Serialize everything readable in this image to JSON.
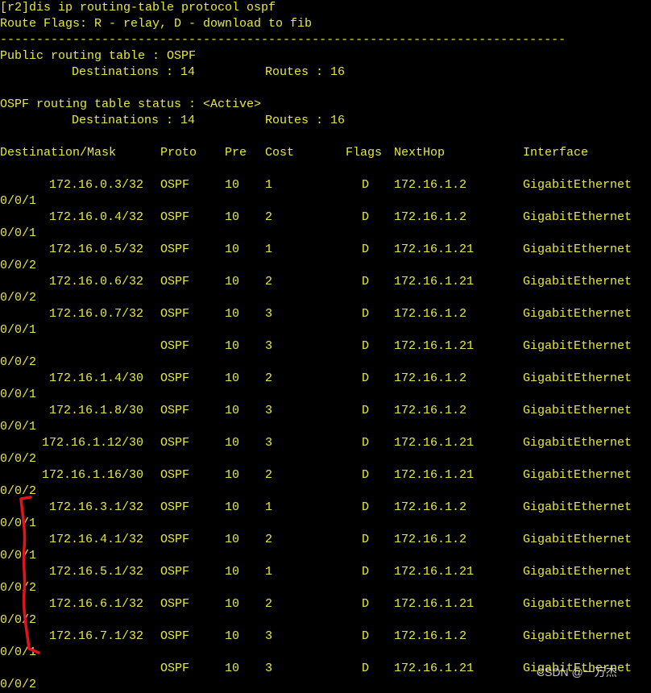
{
  "command": "[r2]dis ip routing-table protocol ospf",
  "route_flags": "Route Flags: R - relay, D - download to fib",
  "separator": "------------------------------------------------------------------------------",
  "public_table": {
    "title": "Public routing table : OSPF",
    "destinations": "Destinations : 14",
    "routes": "Routes : 16"
  },
  "status_table": {
    "title": "OSPF routing table status : <Active>",
    "destinations": "Destinations : 14",
    "routes": "Routes : 16"
  },
  "headers": {
    "destination": "Destination/Mask",
    "proto": "Proto",
    "pre": "Pre",
    "cost": "Cost",
    "flags": "Flags",
    "nexthop": "NextHop",
    "interface": "Interface"
  },
  "routes": [
    {
      "dest": "172.16.0.3/32",
      "proto": "OSPF",
      "pre": "10",
      "cost": "1",
      "flags": "D",
      "nexthop": "172.16.1.2",
      "iface": "GigabitEthernet",
      "iface_tail": "0/0/1"
    },
    {
      "dest": "172.16.0.4/32",
      "proto": "OSPF",
      "pre": "10",
      "cost": "2",
      "flags": "D",
      "nexthop": "172.16.1.2",
      "iface": "GigabitEthernet",
      "iface_tail": "0/0/1"
    },
    {
      "dest": "172.16.0.5/32",
      "proto": "OSPF",
      "pre": "10",
      "cost": "1",
      "flags": "D",
      "nexthop": "172.16.1.21",
      "iface": "GigabitEthernet",
      "iface_tail": "0/0/2"
    },
    {
      "dest": "172.16.0.6/32",
      "proto": "OSPF",
      "pre": "10",
      "cost": "2",
      "flags": "D",
      "nexthop": "172.16.1.21",
      "iface": "GigabitEthernet",
      "iface_tail": "0/0/2"
    },
    {
      "dest": "172.16.0.7/32",
      "proto": "OSPF",
      "pre": "10",
      "cost": "3",
      "flags": "D",
      "nexthop": "172.16.1.2",
      "iface": "GigabitEthernet",
      "iface_tail": "0/0/1"
    },
    {
      "dest": "",
      "proto": "OSPF",
      "pre": "10",
      "cost": "3",
      "flags": "D",
      "nexthop": "172.16.1.21",
      "iface": "GigabitEthernet",
      "iface_tail": "0/0/2"
    },
    {
      "dest": "172.16.1.4/30",
      "proto": "OSPF",
      "pre": "10",
      "cost": "2",
      "flags": "D",
      "nexthop": "172.16.1.2",
      "iface": "GigabitEthernet",
      "iface_tail": "0/0/1"
    },
    {
      "dest": "172.16.1.8/30",
      "proto": "OSPF",
      "pre": "10",
      "cost": "3",
      "flags": "D",
      "nexthop": "172.16.1.2",
      "iface": "GigabitEthernet",
      "iface_tail": "0/0/1"
    },
    {
      "dest": "172.16.1.12/30",
      "proto": "OSPF",
      "pre": "10",
      "cost": "3",
      "flags": "D",
      "nexthop": "172.16.1.21",
      "iface": "GigabitEthernet",
      "iface_tail": "0/0/2"
    },
    {
      "dest": "172.16.1.16/30",
      "proto": "OSPF",
      "pre": "10",
      "cost": "2",
      "flags": "D",
      "nexthop": "172.16.1.21",
      "iface": "GigabitEthernet",
      "iface_tail": "0/0/2"
    },
    {
      "dest": "172.16.3.1/32",
      "proto": "OSPF",
      "pre": "10",
      "cost": "1",
      "flags": "D",
      "nexthop": "172.16.1.2",
      "iface": "GigabitEthernet",
      "iface_tail": "0/0/1"
    },
    {
      "dest": "172.16.4.1/32",
      "proto": "OSPF",
      "pre": "10",
      "cost": "2",
      "flags": "D",
      "nexthop": "172.16.1.2",
      "iface": "GigabitEthernet",
      "iface_tail": "0/0/1"
    },
    {
      "dest": "172.16.5.1/32",
      "proto": "OSPF",
      "pre": "10",
      "cost": "1",
      "flags": "D",
      "nexthop": "172.16.1.21",
      "iface": "GigabitEthernet",
      "iface_tail": "0/0/2"
    },
    {
      "dest": "172.16.6.1/32",
      "proto": "OSPF",
      "pre": "10",
      "cost": "2",
      "flags": "D",
      "nexthop": "172.16.1.21",
      "iface": "GigabitEthernet",
      "iface_tail": "0/0/2"
    },
    {
      "dest": "172.16.7.1/32",
      "proto": "OSPF",
      "pre": "10",
      "cost": "3",
      "flags": "D",
      "nexthop": "172.16.1.2",
      "iface": "GigabitEthernet",
      "iface_tail": "0/0/1"
    },
    {
      "dest": "",
      "proto": "OSPF",
      "pre": "10",
      "cost": "3",
      "flags": "D",
      "nexthop": "172.16.1.21",
      "iface": "GigabitEthernet",
      "iface_tail": "0/0/2"
    }
  ],
  "watermark": "CSDN @一万杰",
  "colors": {
    "background": "#000000",
    "text": "#e8e840",
    "annotation": "#e0141c"
  }
}
